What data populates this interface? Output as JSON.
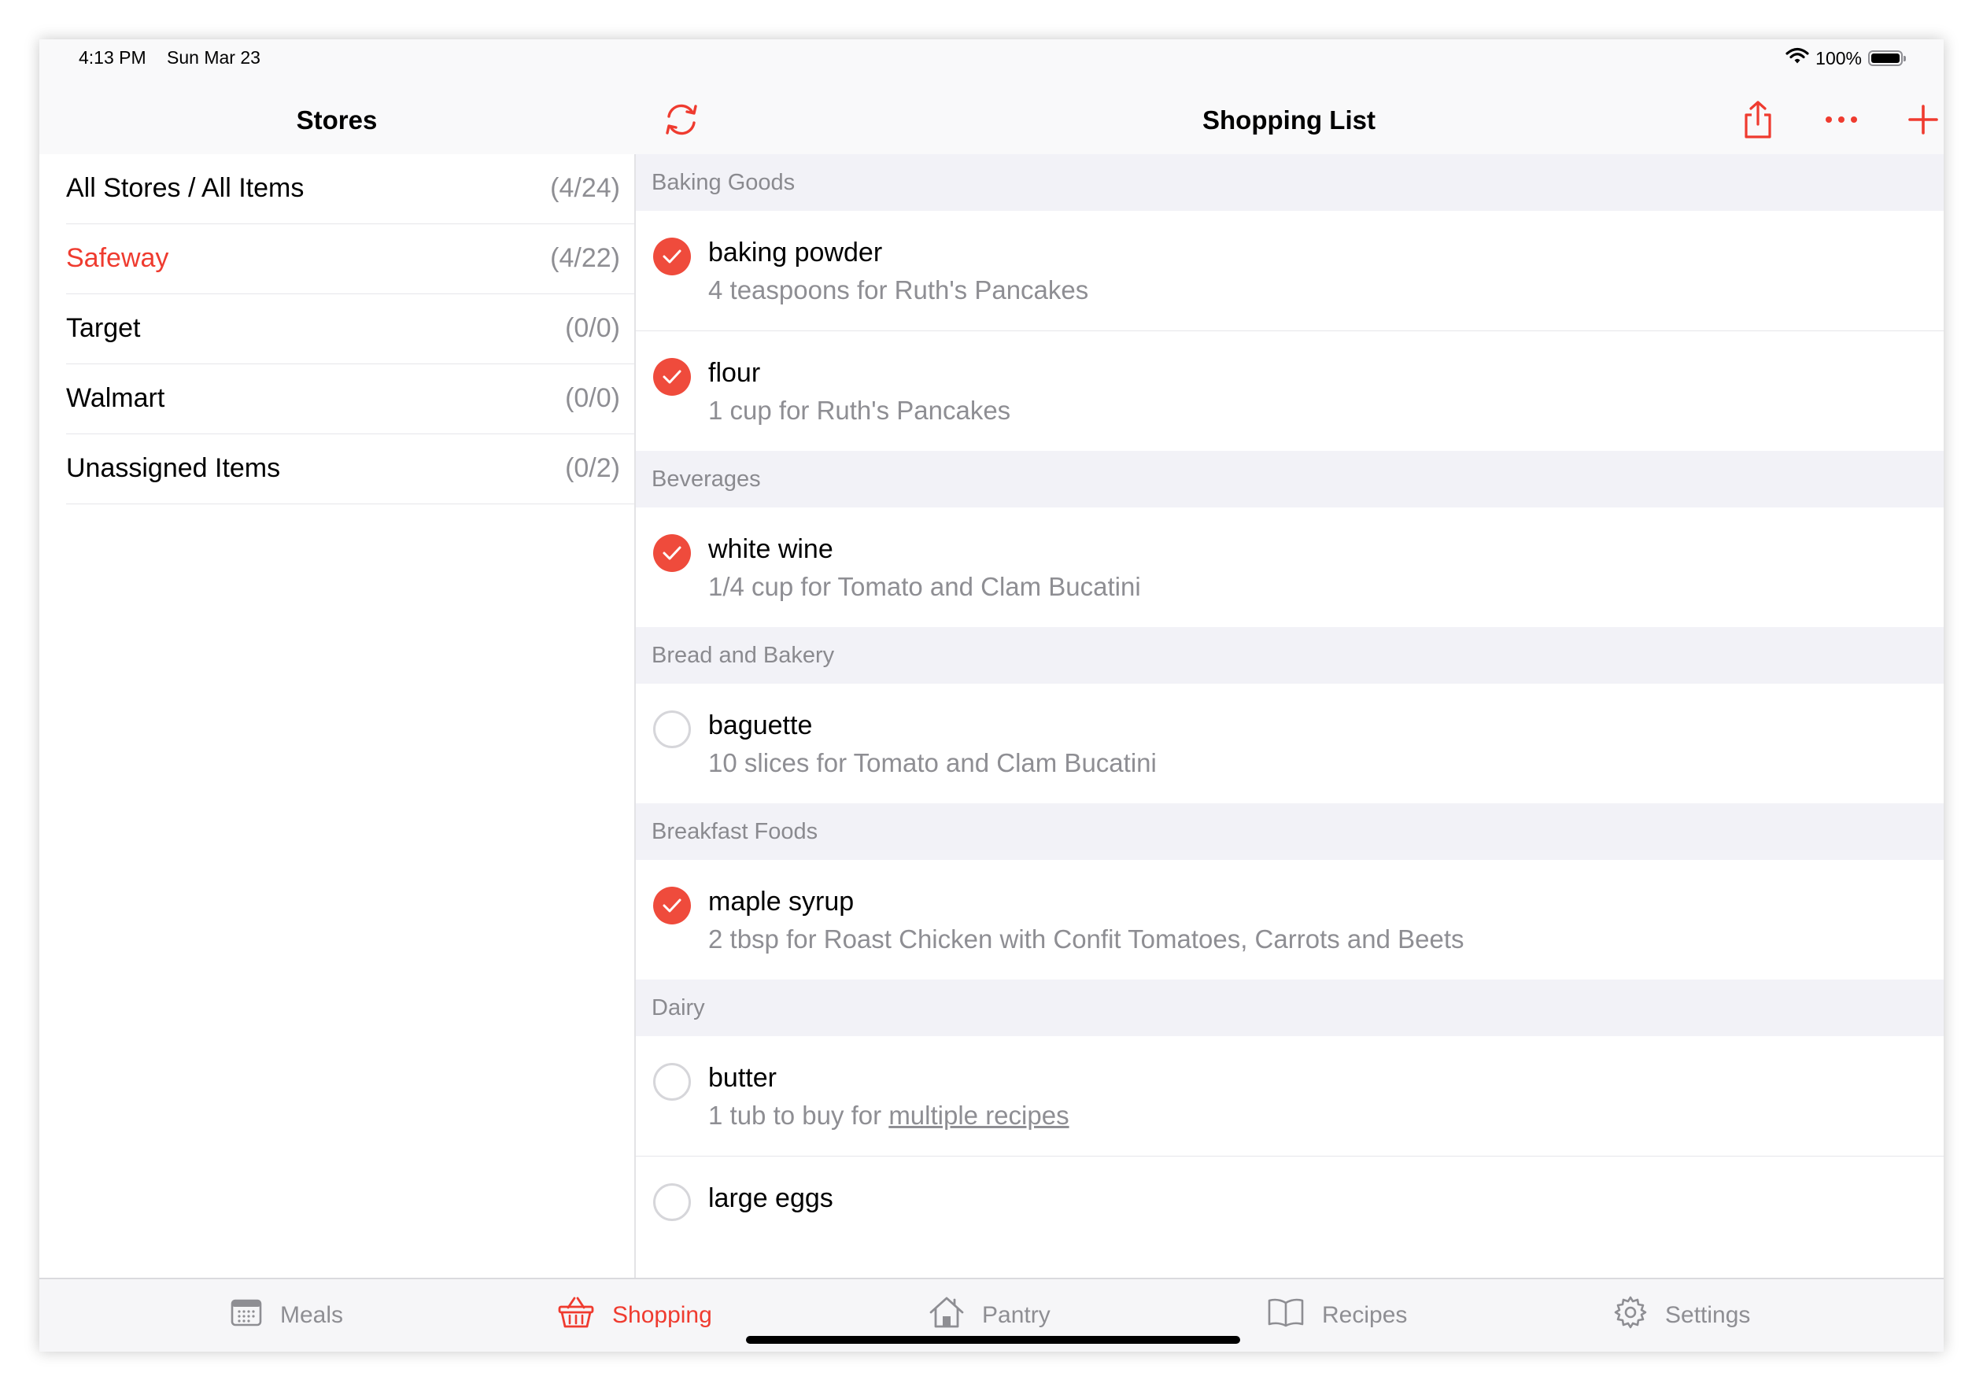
{
  "status": {
    "time": "4:13 PM",
    "date": "Sun Mar 23",
    "battery": "100%"
  },
  "sidebar": {
    "title": "Stores",
    "stores": [
      {
        "name": "All Stores / All Items",
        "count": "(4/24)"
      },
      {
        "name": "Safeway",
        "count": "(4/22)",
        "active": true
      },
      {
        "name": "Target",
        "count": "(0/0)"
      },
      {
        "name": "Walmart",
        "count": "(0/0)"
      },
      {
        "name": "Unassigned Items",
        "count": "(0/2)"
      }
    ]
  },
  "main": {
    "title": "Shopping List",
    "sections": [
      {
        "header": "Baking Goods",
        "items": [
          {
            "name": "baking powder",
            "detail": "4 teaspoons for Ruth's Pancakes",
            "checked": true
          },
          {
            "name": "flour",
            "detail": "1 cup for Ruth's Pancakes",
            "checked": true
          }
        ]
      },
      {
        "header": "Beverages",
        "items": [
          {
            "name": "white wine",
            "detail": "1/4 cup for Tomato and Clam Bucatini",
            "checked": true
          }
        ]
      },
      {
        "header": "Bread and Bakery",
        "items": [
          {
            "name": "baguette",
            "detail": "10 slices for Tomato and Clam Bucatini",
            "checked": false
          }
        ]
      },
      {
        "header": "Breakfast Foods",
        "items": [
          {
            "name": "maple syrup",
            "detail": "2 tbsp for Roast Chicken with Confit Tomatoes, Carrots and Beets",
            "checked": true
          }
        ]
      },
      {
        "header": "Dairy",
        "items": [
          {
            "name": "butter",
            "detail_prefix": "1 tub to buy for ",
            "detail_link": "multiple recipes",
            "checked": false
          },
          {
            "name": "large eggs",
            "checked": false
          }
        ]
      }
    ]
  },
  "tabs": [
    {
      "label": "Meals",
      "icon": "calendar-icon"
    },
    {
      "label": "Shopping",
      "icon": "basket-icon",
      "active": true
    },
    {
      "label": "Pantry",
      "icon": "house-icon"
    },
    {
      "label": "Recipes",
      "icon": "book-icon"
    },
    {
      "label": "Settings",
      "icon": "gear-icon"
    }
  ],
  "colors": {
    "accent": "#ef3b2f",
    "check": "#ef4b3c",
    "secondary_text": "#8e8e93",
    "section_bg": "#f2f2f7"
  }
}
